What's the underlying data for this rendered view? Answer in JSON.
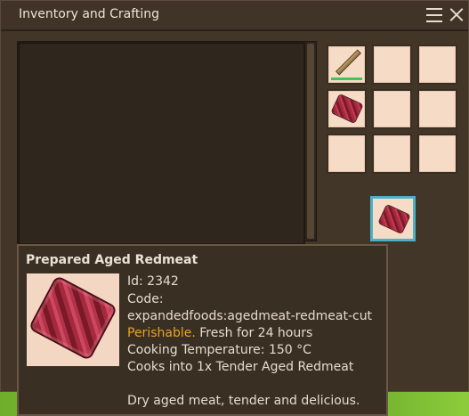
{
  "window": {
    "title": "Inventory and Crafting"
  },
  "crafting_grid": {
    "slots": [
      {
        "item": "stick",
        "icon": "stick-icon",
        "has_durability": true
      },
      {
        "item": "",
        "icon": ""
      },
      {
        "item": "",
        "icon": ""
      },
      {
        "item": "raw meat",
        "icon": "redmeat-icon"
      },
      {
        "item": "",
        "icon": ""
      },
      {
        "item": "",
        "icon": ""
      },
      {
        "item": "",
        "icon": ""
      },
      {
        "item": "",
        "icon": ""
      },
      {
        "item": "",
        "icon": ""
      }
    ],
    "output": {
      "icon": "redmeat-icon",
      "highlight_color": "#4bb1c6"
    }
  },
  "tooltip": {
    "title": "Prepared Aged Redmeat",
    "id": "Id: 2342",
    "code_label": "Code:",
    "code": "expandedfoods:agedmeat-redmeat-cut",
    "perishable": "Perishable.",
    "freshness": "Fresh for 24 hours",
    "cooking_temperature": "Cooking Temperature: 150 °C",
    "cooks_into": "Cooks into 1x Tender Aged Redmeat",
    "description": "Dry aged meat, tender and delicious."
  },
  "colors": {
    "window_bg": "#423628",
    "slot_bg": "#f6dcc6",
    "perishable": "#e6a22a",
    "durability": "#41c45b"
  }
}
